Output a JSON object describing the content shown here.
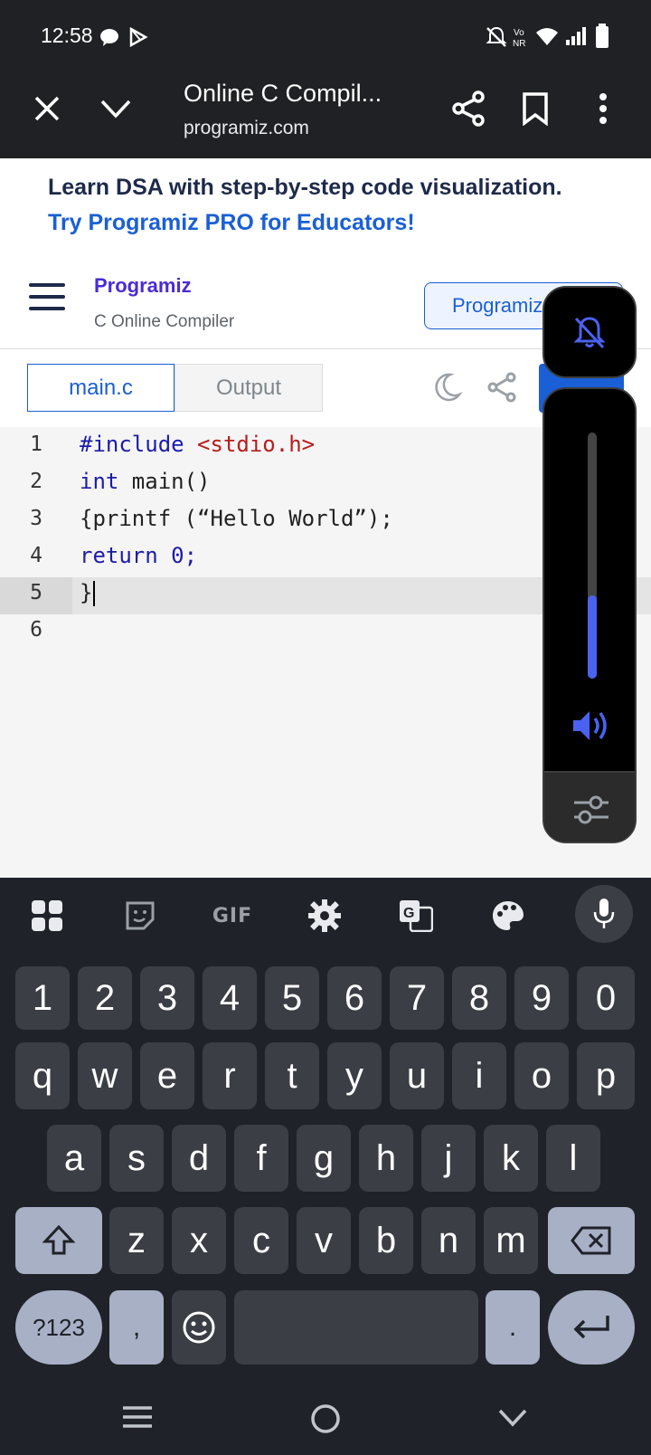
{
  "status_bar": {
    "time": "12:58"
  },
  "browser": {
    "title": "Online C Compil...",
    "domain": "programiz.com"
  },
  "promo": {
    "line1": "Learn DSA with step-by-step code visualization.",
    "line2": "Try Programiz PRO for Educators!"
  },
  "site": {
    "logo_text": "Programiz",
    "subtitle": "C Online Compiler",
    "pro_button": "Programiz PRO"
  },
  "tabs": {
    "main": "main.c",
    "output": "Output"
  },
  "editor": {
    "line_numbers": [
      "1",
      "2",
      "3",
      "4",
      "5",
      "6"
    ],
    "lines": [
      {
        "a": "#include ",
        "b": "<stdio.h>"
      },
      {
        "a": "int",
        "b": " main()"
      },
      {
        "a": "{printf (“Hello World”);"
      },
      {
        "a": "return",
        "b": " 0;"
      },
      {
        "a": "}"
      },
      {
        "a": ""
      }
    ]
  },
  "volume": {
    "level_percent": 34,
    "accent": "#4a62f0"
  },
  "keyboard": {
    "toolbar": [
      "apps-icon",
      "sticker-icon",
      "gif-icon",
      "settings-icon",
      "translate-icon",
      "palette-icon",
      "mic-icon"
    ],
    "gif_label": "GIF",
    "row_numbers": [
      "1",
      "2",
      "3",
      "4",
      "5",
      "6",
      "7",
      "8",
      "9",
      "0"
    ],
    "row1": [
      "q",
      "w",
      "e",
      "r",
      "t",
      "y",
      "u",
      "i",
      "o",
      "p"
    ],
    "row2": [
      "a",
      "s",
      "d",
      "f",
      "g",
      "h",
      "j",
      "k",
      "l"
    ],
    "row3": [
      "z",
      "x",
      "c",
      "v",
      "b",
      "n",
      "m"
    ],
    "symbols_key": "?123",
    "comma_key": ",",
    "period_key": "."
  },
  "colors": {
    "brand_blue": "#1a5fd6",
    "keyboard_bg": "#1f2228",
    "key_bg": "#3b3e45",
    "func_key_bg": "#a8b0c6"
  }
}
